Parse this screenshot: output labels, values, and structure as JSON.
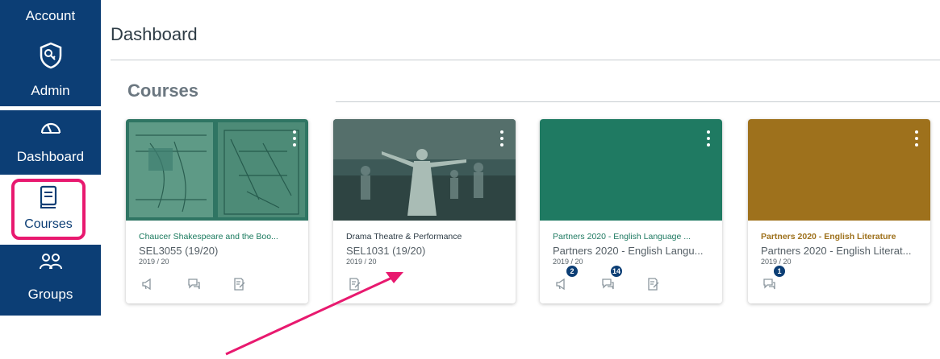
{
  "sidebar": {
    "account_label": "Account",
    "admin_label": "Admin",
    "dashboard_label": "Dashboard",
    "courses_label": "Courses",
    "groups_label": "Groups"
  },
  "page": {
    "title": "Dashboard",
    "section_title": "Courses"
  },
  "cards": [
    {
      "name": "Chaucer Shakespeare and the Boo...",
      "code": "SEL3055 (19/20)",
      "term": "2019 / 20",
      "color": "#1f6d5c",
      "name_color": "#1a7a5e",
      "hero": "image-manuscript"
    },
    {
      "name": "Drama Theatre & Performance",
      "code": "SEL1031 (19/20)",
      "term": "2019 / 20",
      "color": "#3e5a57",
      "name_color": "#2d3b45",
      "hero": "image-dancers"
    },
    {
      "name": "Partners 2020 - English Language ...",
      "code": "Partners 2020 - English Langu...",
      "term": "2019 / 20",
      "color": "#1f7a62",
      "name_color": "#1f7a62",
      "badges": {
        "announcements": "2",
        "discussions": "14"
      }
    },
    {
      "name": "Partners 2020 - English Literature",
      "code": "Partners 2020 - English Literat...",
      "term": "2019 / 20",
      "color": "#9e711c",
      "name_color": "#9e711c",
      "badges": {
        "discussions": "1"
      }
    }
  ],
  "colors": {
    "nav_bg": "#0c3e75",
    "highlight": "#e8196f"
  }
}
